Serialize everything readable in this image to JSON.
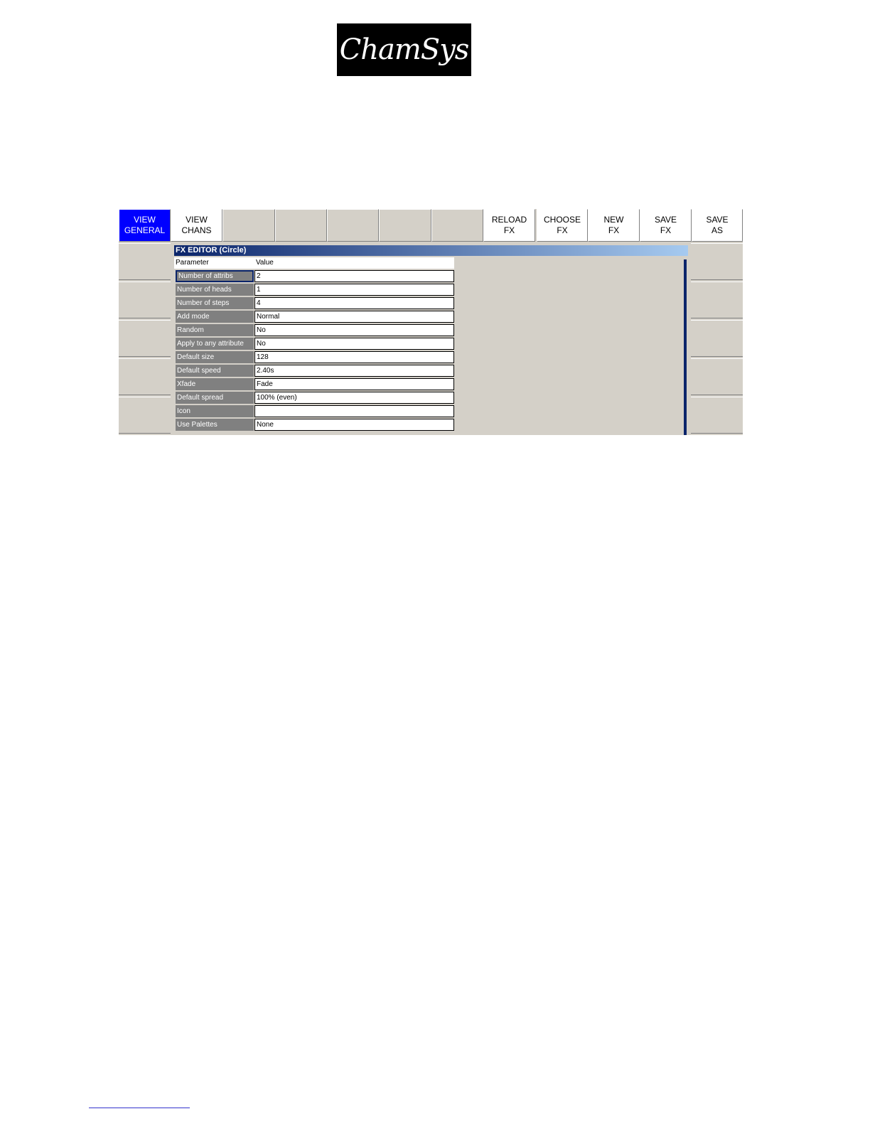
{
  "logo": {
    "text": "ChamSys"
  },
  "softkeys": [
    {
      "line1": "VIEW",
      "line2": "GENERAL",
      "active": true
    },
    {
      "line1": "VIEW",
      "line2": "CHANS"
    },
    {
      "line1": "",
      "line2": ""
    },
    {
      "line1": "",
      "line2": ""
    },
    {
      "line1": "",
      "line2": ""
    },
    {
      "line1": "",
      "line2": ""
    },
    {
      "line1": "",
      "line2": ""
    },
    {
      "line1": "RELOAD",
      "line2": "FX"
    },
    {
      "line1": "CHOOSE",
      "line2": "FX"
    },
    {
      "line1": "NEW",
      "line2": "FX"
    },
    {
      "line1": "SAVE",
      "line2": "FX"
    },
    {
      "line1": "SAVE",
      "line2": "AS"
    }
  ],
  "fx_editor": {
    "title": "FX EDITOR (Circle)",
    "header": {
      "parameter": "Parameter",
      "value": "Value"
    },
    "rows": [
      {
        "name": "Number of attribs",
        "value": "2",
        "selected": true
      },
      {
        "name": "Number of heads",
        "value": "1"
      },
      {
        "name": "Number of steps",
        "value": "4"
      },
      {
        "name": "Add mode",
        "value": "Normal"
      },
      {
        "name": "Random",
        "value": "No"
      },
      {
        "name": "Apply to any attribute",
        "value": "No"
      },
      {
        "name": "Default size",
        "value": "128"
      },
      {
        "name": "Default speed",
        "value": "2.40s"
      },
      {
        "name": "Xfade",
        "value": "Fade"
      },
      {
        "name": "Default spread",
        "value": "100% (even)"
      },
      {
        "name": "Icon",
        "value": ""
      },
      {
        "name": "Use Palettes",
        "value": "None"
      }
    ]
  }
}
